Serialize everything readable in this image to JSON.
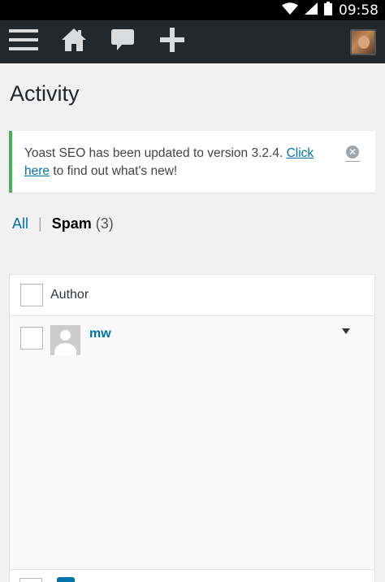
{
  "status_bar": {
    "time": "09:58"
  },
  "admin_bar": {
    "icons": [
      "menu-icon",
      "home-icon",
      "comment-icon",
      "plus-icon",
      "user-avatar"
    ]
  },
  "page": {
    "title": "Activity"
  },
  "notice": {
    "text_before": "Yoast SEO has been updated to version 3.2.4. ",
    "link_text": "Click here",
    "text_after": " to find out what's new!",
    "dismiss_icon": "dismiss-icon"
  },
  "filters": {
    "all_label": "All",
    "separator": "|",
    "spam_label": "Spam",
    "spam_count": "(3)"
  },
  "table": {
    "header_author": "Author",
    "rows": [
      {
        "author": "mw"
      }
    ]
  },
  "colors": {
    "admin_bar": "#23282d",
    "link": "#0073aa",
    "notice_success": "#46b450"
  }
}
